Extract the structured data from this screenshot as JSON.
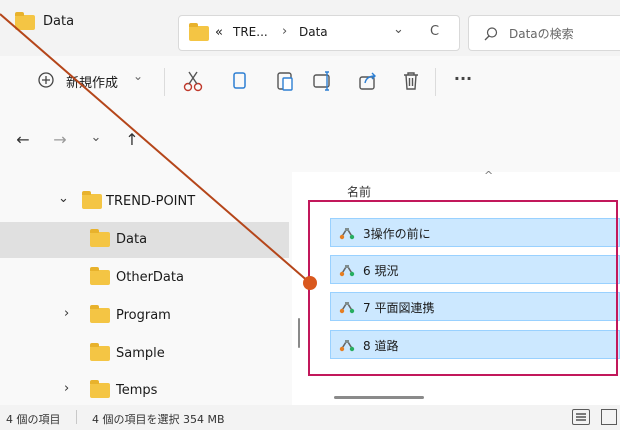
{
  "window": {
    "title": "Data",
    "minimize_glyph": "—",
    "maximize_glyph": "☐",
    "close_glyph": "✕"
  },
  "commandbar": {
    "new_label": "新規作成",
    "new_chevron": "⌄",
    "more_glyph": "···",
    "icons": [
      "cut-icon",
      "copy-icon",
      "paste-icon",
      "rename-icon",
      "share-icon",
      "delete-icon"
    ]
  },
  "address": {
    "back": "←",
    "forward": "→",
    "recent": "⌄",
    "up": "↑",
    "overflow": "«",
    "crumb1": "TRE...",
    "sep": "›",
    "crumb2": "Data",
    "dropdown": "⌄",
    "refresh": "C",
    "search_placeholder": "Dataの検索"
  },
  "nav": {
    "items": [
      {
        "label": "TREND-POINT",
        "chevron": "⌄"
      },
      {
        "label": "Data"
      },
      {
        "label": "OtherData"
      },
      {
        "label": "Program",
        "chevron": "›"
      },
      {
        "label": "Sample"
      },
      {
        "label": "Temps",
        "chevron": "›"
      }
    ]
  },
  "files": {
    "column_header": "名前",
    "sort_glyph": "^",
    "rows": [
      {
        "label": "3操作の前に"
      },
      {
        "label": "6 現況"
      },
      {
        "label": "7 平面図連携"
      },
      {
        "label": "8 道路"
      }
    ]
  },
  "status": {
    "count": "4 個の項目",
    "selected": "4 個の項目を選択  354 MB"
  },
  "colors": {
    "accent": "#c2185b",
    "leader": "#b5461a",
    "selection": "#cce8ff",
    "folder": "#f4c544"
  }
}
